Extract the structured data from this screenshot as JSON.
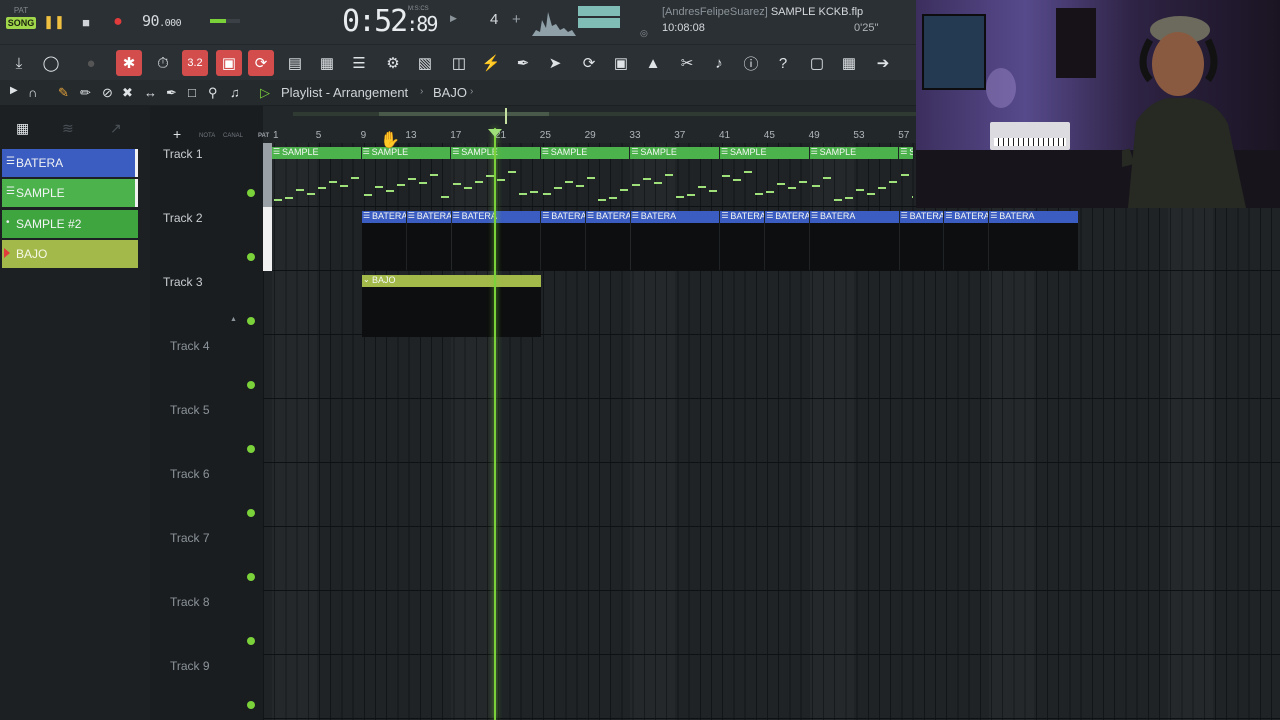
{
  "transport": {
    "pat_label": "PAT",
    "song_label": "SONG",
    "tempo_main": "90",
    "tempo_dec": ".000",
    "time_main": "0:52",
    "time_cs": ":89",
    "time_label": "M:S:CS",
    "pattern_number": "4",
    "pattern_plus": "+",
    "hint_user": "[AndresFelipeSuarez]",
    "hint_project": "SAMPLE KCKB.flp",
    "clock": "10:08:08",
    "duration": "0'25''"
  },
  "playlist": {
    "title": "Playlist - Arrangement",
    "current_pattern": "BAJO",
    "pat_label": "PAT",
    "nota_label": "NOTA",
    "canal_label": "CANAL"
  },
  "patterns": [
    {
      "label": "BATERA",
      "color": "#3b5cc0"
    },
    {
      "label": "SAMPLE",
      "color": "#4cb34c"
    },
    {
      "label": "SAMPLE #2",
      "color": "#3fa53f"
    },
    {
      "label": "BAJO",
      "color": "#a3b94a"
    }
  ],
  "ruler_ticks": [
    "1",
    "5",
    "9",
    "13",
    "17",
    "21",
    "25",
    "29",
    "33",
    "37",
    "41",
    "45",
    "49",
    "53",
    "57"
  ],
  "tracks": [
    {
      "name": "Track 1"
    },
    {
      "name": "Track 2"
    },
    {
      "name": "Track 3"
    },
    {
      "name": "Track 4"
    },
    {
      "name": "Track 5"
    },
    {
      "name": "Track 6"
    },
    {
      "name": "Track 7"
    },
    {
      "name": "Track 8"
    },
    {
      "name": "Track 9"
    }
  ],
  "clips": {
    "sample_label": "SAMPLE",
    "batera_label": "BATERA",
    "bajo_label": "BAJO"
  },
  "colors": {
    "accent_green": "#7ad13a",
    "record_red": "#e23b3b",
    "batera_blue": "#3b5cc0",
    "sample_green": "#4cb34c",
    "bajo_olive": "#a3b94a"
  }
}
